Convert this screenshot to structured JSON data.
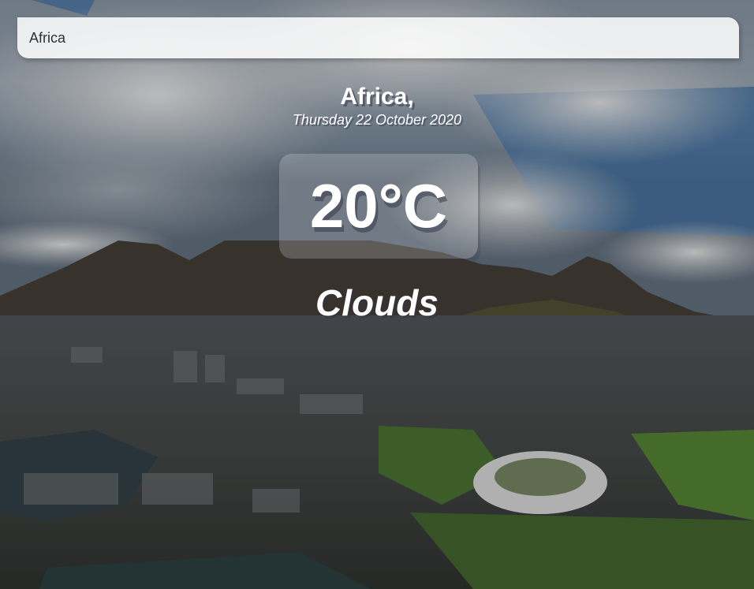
{
  "search": {
    "value": "Africa"
  },
  "location": {
    "name": "Africa,",
    "date": "Thursday 22 October 2020"
  },
  "weather": {
    "temperature": "20°C",
    "condition": "Clouds"
  },
  "background": {
    "description_icon": "city-landscape-photo-icon"
  }
}
